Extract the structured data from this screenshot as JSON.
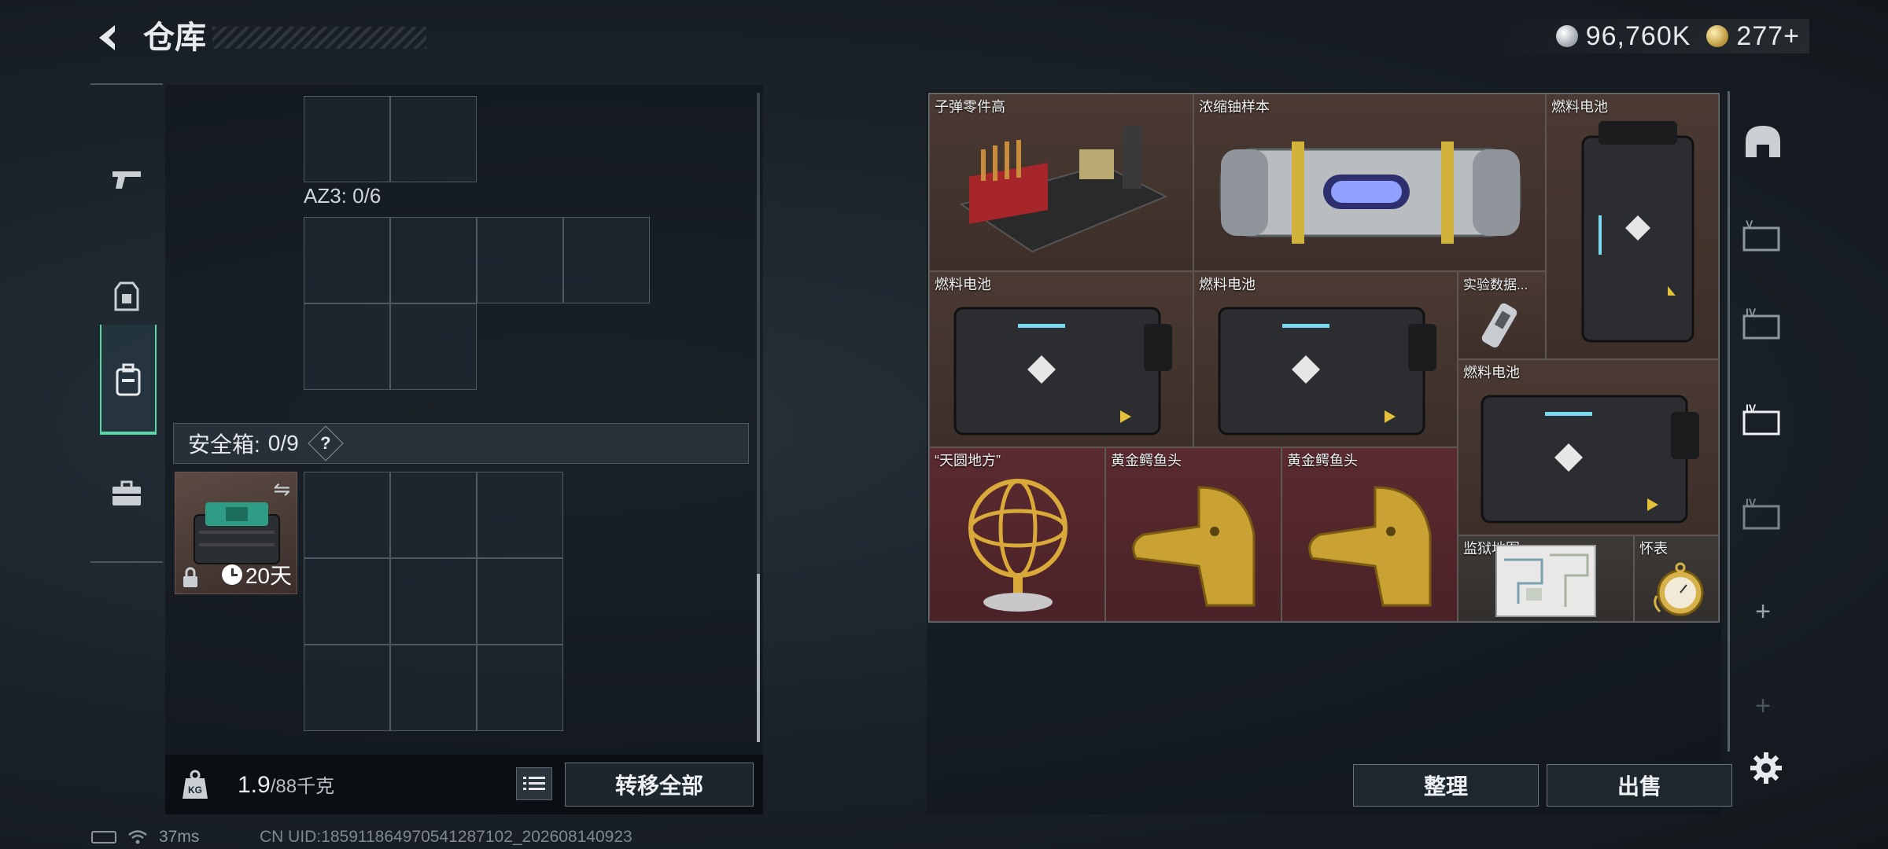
{
  "header": {
    "title": "仓库",
    "currency_silver": "96,760K",
    "currency_gold": "277+"
  },
  "left_nav": [
    "weapon",
    "armor",
    "backpack",
    "toolbox"
  ],
  "inventory": {
    "az3_label": "AZ3: 0/6",
    "safebox_label": "安全箱:",
    "safebox_count": "0/9",
    "help_symbol": "?",
    "safebox_swap_symbol": "⇋",
    "safebox_timer": "20天"
  },
  "footer_left": {
    "weight_value": "1.9",
    "weight_max": "/88千克",
    "transfer_label": "转移全部"
  },
  "status": {
    "ping": "37ms",
    "uid": "CN UID:185911864970541287102_202608140923"
  },
  "container_items": [
    {
      "name": "子弹零件高",
      "color": "brown"
    },
    {
      "name": "浓缩铀样本",
      "color": "brown"
    },
    {
      "name": "燃料电池",
      "color": "brown"
    },
    {
      "name": "燃料电池",
      "color": "brown"
    },
    {
      "name": "燃料电池",
      "color": "brown"
    },
    {
      "name": "实验数据...",
      "color": "brown"
    },
    {
      "name": "燃料电池",
      "color": "brown"
    },
    {
      "name": "“天圆地方”",
      "color": "red"
    },
    {
      "name": "黄金鳄鱼头",
      "color": "red"
    },
    {
      "name": "黄金鳄鱼头",
      "color": "red"
    },
    {
      "name": "监狱地图",
      "color": "grey"
    },
    {
      "name": "怀表",
      "color": "grey"
    }
  ],
  "right_nav": {
    "add_symbol": "+"
  },
  "actions": {
    "sort_label": "整理",
    "sell_label": "出售"
  }
}
